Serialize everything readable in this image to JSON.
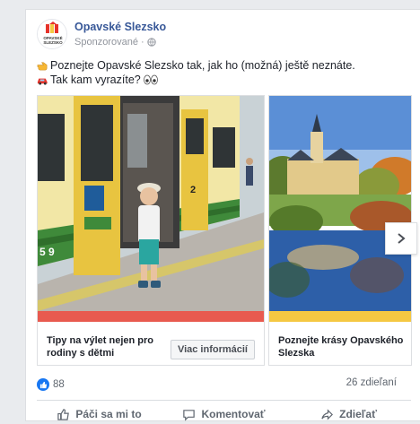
{
  "post": {
    "page_name": "Opavské Slezsko",
    "sponsored": "Sponzorované ·",
    "logo_text": [
      "OPAVSKÉ",
      "SLEZSKO"
    ],
    "text_line1": "Poznejte Opavské Slezsko tak, jak ho (možná) ještě neznáte.",
    "text_line2": "Tak kam vyrazíte?",
    "icons": {
      "line1": "pointing-hand-icon",
      "line2": "car-icon",
      "line2_end": "eyes-icon",
      "privacy": "globe-icon"
    }
  },
  "carousel": {
    "cards": [
      {
        "title": "Tipy na výlet nejen pro rodiny s dětmi",
        "cta": "Viac informácií",
        "strip_color": "#e85a4f",
        "train_number": "5 9",
        "car_number": "2"
      },
      {
        "title": "Poznejte krásy Opavského Slezska",
        "strip_color": "#f5c842"
      }
    ],
    "next_icon": "chevron-right-icon"
  },
  "engagement": {
    "likes": "88",
    "shares": "26 zdieľaní"
  },
  "actions": {
    "like": "Páči sa mi to",
    "comment": "Komentovať",
    "share": "Zdieľať"
  },
  "colors": {
    "link_blue": "#385898",
    "fb_blue": "#1877f2",
    "gray_text": "#606770"
  }
}
